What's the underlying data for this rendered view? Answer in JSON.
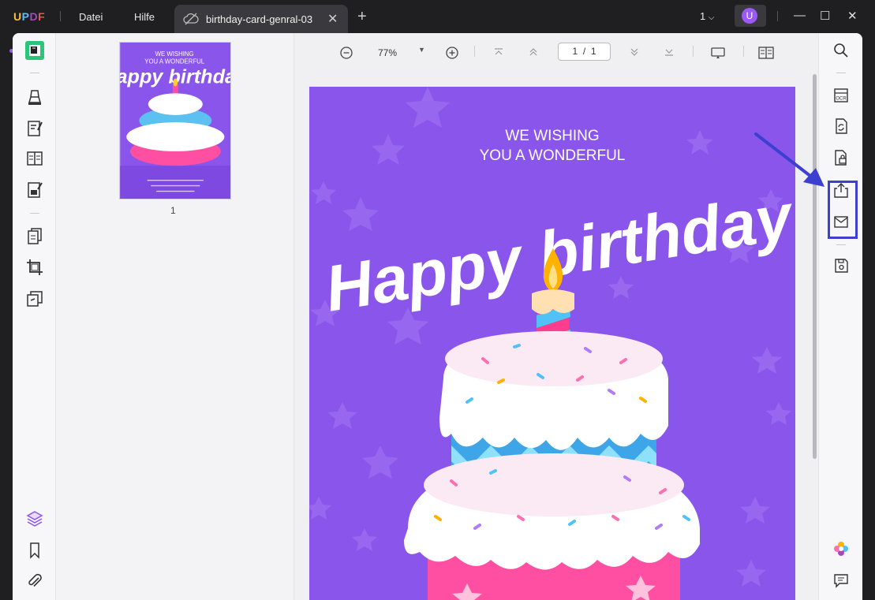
{
  "app": {
    "logo": "UPDF",
    "menu": [
      "Datei",
      "Hilfe"
    ],
    "tab_title": "birthday-card-genral-03",
    "window_count": "1",
    "avatar_letter": "U"
  },
  "viewer": {
    "zoom": "77%",
    "page_current": "1",
    "page_total": "1",
    "page_sep": "/"
  },
  "thumbnail": {
    "page_number": "1"
  },
  "card": {
    "line1": "WE WISHING",
    "line2": "YOU A WONDERFUL",
    "headline": "Happy birthday",
    "background": "#8a55ea"
  },
  "icons": {
    "left": [
      "edit-text-icon",
      "highlight-icon",
      "comment-edit-icon",
      "reader-icon",
      "form-icon",
      "organize-pages-icon",
      "crop-icon",
      "page-tools-icon",
      "layers-icon",
      "bookmark-icon",
      "attachment-icon"
    ],
    "right": [
      "search-icon",
      "ocr-icon",
      "convert-icon",
      "protect-icon",
      "share-icon",
      "email-icon",
      "save-icon",
      "ai-icon",
      "chat-icon"
    ]
  },
  "colors": {
    "accent": "#9b59f5",
    "highlight": "#3d3fd0"
  }
}
